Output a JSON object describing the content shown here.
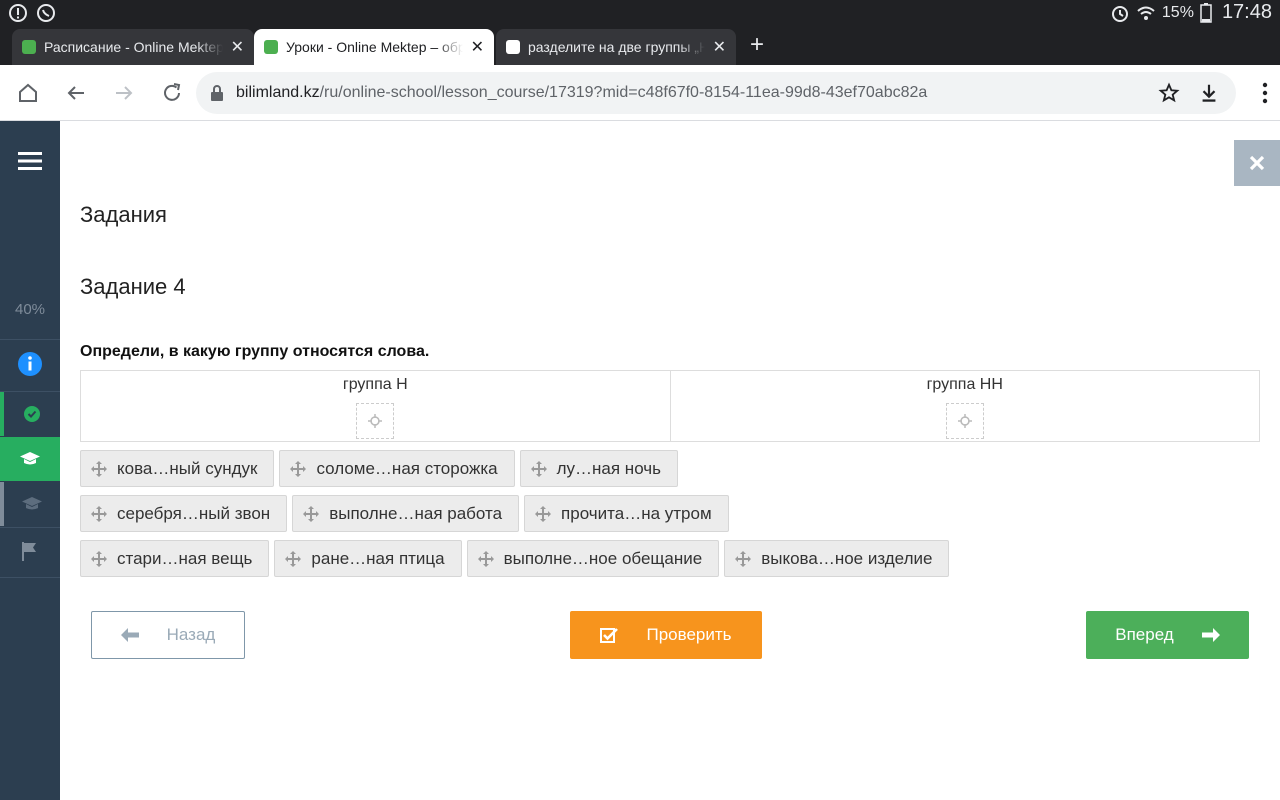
{
  "statusbar": {
    "battery": "15%",
    "time": "17:48"
  },
  "tabs": [
    {
      "title": "Расписание - Online Mektep",
      "favicon_color": "#4caf50"
    },
    {
      "title": "Уроки - Online Mektep – образовательная платформа",
      "favicon_color": "#4caf50"
    },
    {
      "title": "разделите на две группы „Н“ и „НН“",
      "favicon_color": "#ffffff"
    }
  ],
  "address": {
    "host": "bilimland.kz",
    "path": "/ru/online-school/lesson_course/17319?mid=c48f67f0-8154-11ea-99d8-43ef70abc82a"
  },
  "sidebar": {
    "progress": "40%"
  },
  "page": {
    "section_title": "Задания",
    "task_title": "Задание 4",
    "instruction": "Определи, в какую группу относятся слова.",
    "groups": [
      "группа Н",
      "группа НН"
    ],
    "words": [
      [
        "кова…ный сундук",
        "соломе…ная сторожка",
        "лу…ная ночь"
      ],
      [
        "серебря…ный звон",
        "выполне…ная работа",
        "прочита…на утром"
      ],
      [
        "стари…ная вещь",
        "ране…ная птица",
        "выполне…ное обещание",
        "выкова…ное изделие"
      ]
    ],
    "buttons": {
      "back": "Назад",
      "check": "Проверить",
      "next": "Вперед"
    }
  },
  "colors": {
    "sidebar": "#2c3e50",
    "check": "#f7941d",
    "next": "#4caf5a",
    "active_green": "#27ae60"
  }
}
